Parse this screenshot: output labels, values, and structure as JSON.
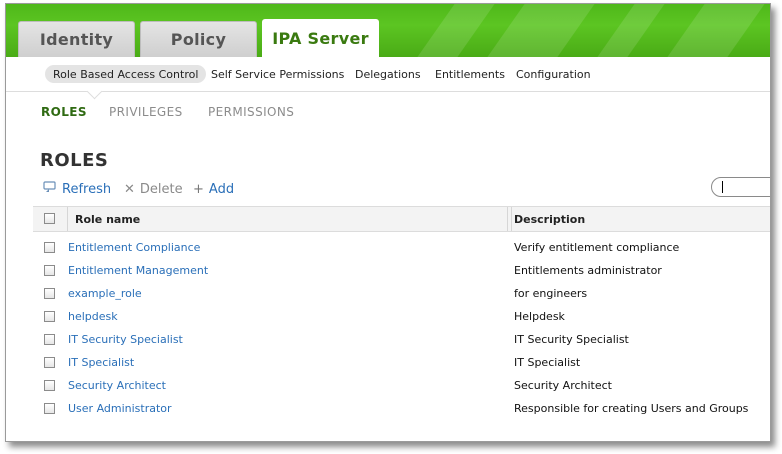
{
  "main_tabs": [
    {
      "label": "Identity",
      "active": false
    },
    {
      "label": "Policy",
      "active": false
    },
    {
      "label": "IPA Server",
      "active": true
    }
  ],
  "sub_tabs": [
    {
      "label": "Role Based Access Control",
      "selected": true
    },
    {
      "label": "Self Service Permissions",
      "selected": false
    },
    {
      "label": "Delegations",
      "selected": false
    },
    {
      "label": "Entitlements",
      "selected": false
    },
    {
      "label": "Configuration",
      "selected": false
    }
  ],
  "facets": [
    {
      "label": "ROLES",
      "active": true
    },
    {
      "label": "PRIVILEGES",
      "active": false
    },
    {
      "label": "PERMISSIONS",
      "active": false
    }
  ],
  "page_title": "ROLES",
  "actions": {
    "refresh": {
      "label": "Refresh",
      "icon": "refresh-icon",
      "enabled": true
    },
    "delete": {
      "label": "Delete",
      "icon": "delete-x-icon",
      "enabled": false
    },
    "add": {
      "label": "Add",
      "icon": "plus-icon",
      "enabled": true
    }
  },
  "search": {
    "value": "",
    "placeholder": ""
  },
  "table": {
    "columns": [
      "Role name",
      "Description"
    ],
    "rows": [
      {
        "name": "Entitlement Compliance",
        "description": "Verify entitlement compliance"
      },
      {
        "name": "Entitlement Management",
        "description": "Entitlements administrator"
      },
      {
        "name": "example_role",
        "description": "for engineers"
      },
      {
        "name": "helpdesk",
        "description": "Helpdesk"
      },
      {
        "name": "IT Security Specialist",
        "description": "IT Security Specialist"
      },
      {
        "name": "IT Specialist",
        "description": "IT Specialist"
      },
      {
        "name": "Security Architect",
        "description": "Security Architect"
      },
      {
        "name": "User Administrator",
        "description": "Responsible for creating Users and Groups"
      }
    ]
  },
  "colors": {
    "header_green": "#4fb81a",
    "active_tab_text": "#3a7a10",
    "link_blue": "#2a6fb8",
    "facet_active": "#2f6a12"
  }
}
